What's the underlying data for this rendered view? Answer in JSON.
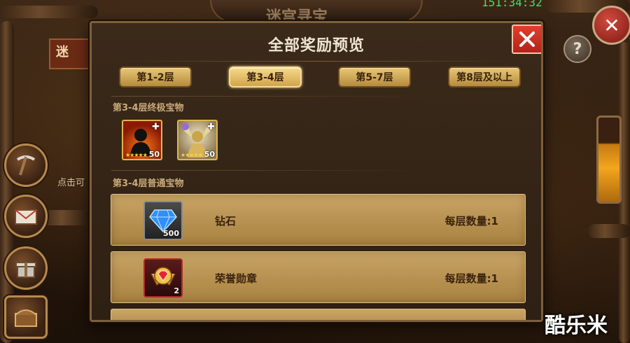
{
  "background": {
    "title": "迷宫寻宝",
    "timer": "151:34:32",
    "left_label": "迷",
    "left_hint": "点击可",
    "help_symbol": "?",
    "close_symbol": "✕"
  },
  "dialog": {
    "title": "全部奖励预览",
    "tabs": [
      {
        "label": "第1-2层",
        "active": false
      },
      {
        "label": "第3-4层",
        "active": true
      },
      {
        "label": "第5-7层",
        "active": false
      },
      {
        "label": "第8层及以上",
        "active": false
      }
    ],
    "ultimate_section": {
      "label": "第3-4层终极宝物",
      "heroes": [
        {
          "name": "silhouette-hero",
          "level": "50",
          "stars": "★★★★★"
        },
        {
          "name": "golden-knight-hero",
          "level": "50",
          "stars": "★★★★★"
        }
      ]
    },
    "normal_section": {
      "label": "第3-4层普通宝物",
      "items": [
        {
          "name": "钻石",
          "quantity": "500",
          "count_text": "每层数量:1",
          "icon": "diamond-icon"
        },
        {
          "name": "荣誉勋章",
          "quantity": "2",
          "count_text": "每层数量:1",
          "icon": "medal-icon"
        }
      ]
    }
  },
  "watermark": "酷乐米",
  "colors": {
    "tab_gold": "#d2a44b",
    "row_gold": "#b89252",
    "close_red": "#c62d20",
    "text_dark": "#3a230c"
  }
}
